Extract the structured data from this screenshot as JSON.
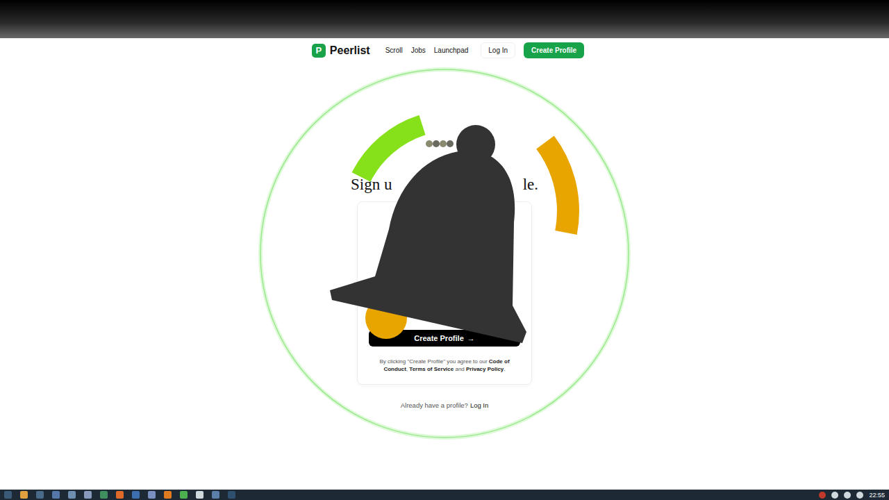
{
  "nav": {
    "logo_mark": "P",
    "brand": "Peerlist",
    "links": [
      {
        "label": "Scroll"
      },
      {
        "label": "Jobs"
      },
      {
        "label": "Launchpad"
      }
    ],
    "login": "Log In",
    "cta": "Create Profile"
  },
  "signup": {
    "heading_start": "Sign u",
    "heading_end": "le.",
    "button": "Create Profile",
    "button_arrow": "→",
    "terms": [
      {
        "text": "By clicking \"Create Profile\" you agree to our ",
        "bold": false
      },
      {
        "text": "Code of Conduct",
        "bold": true
      },
      {
        "text": ", ",
        "bold": false
      },
      {
        "text": "Terms of Service",
        "bold": true
      },
      {
        "text": " and ",
        "bold": false
      },
      {
        "text": "Privacy Policy",
        "bold": true
      },
      {
        "text": ".",
        "bold": false
      }
    ],
    "login_prompt": "Already have a profile?",
    "login_link": "Log In"
  },
  "taskbar": {
    "clock": "22:55"
  }
}
